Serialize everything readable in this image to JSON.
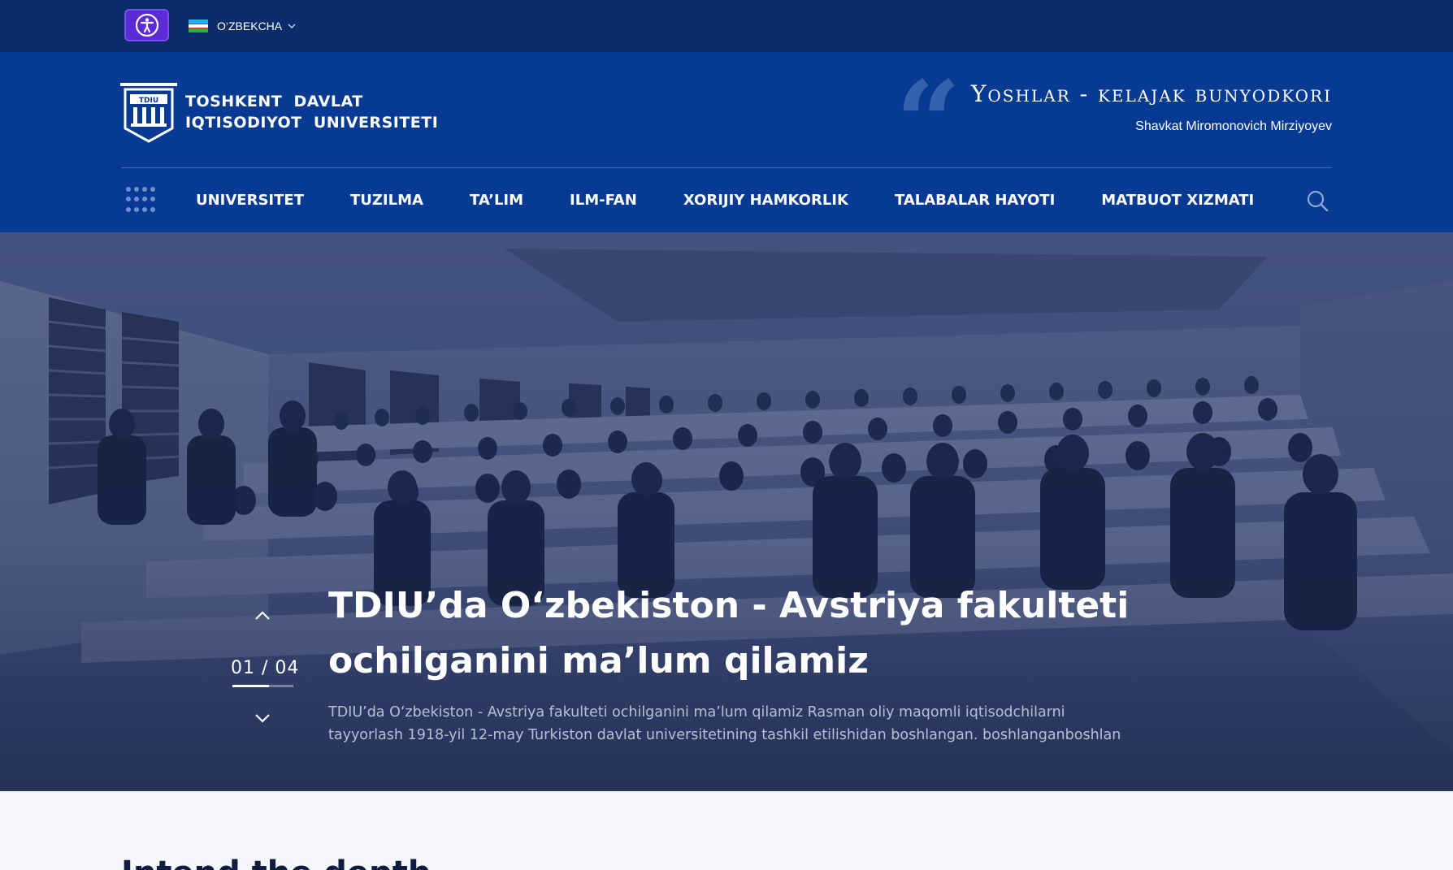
{
  "topbar": {
    "accessibility_icon": "accessibility-icon",
    "language": {
      "label": "O‘ZBEKCHA",
      "flag_colors": [
        "#1eb5e6",
        "#ffffff",
        "#1eb53a"
      ],
      "chevron_icon": "chevron-down-icon"
    }
  },
  "header": {
    "logo": {
      "mark_text": "TDIU",
      "line1": "TOSHKENT  DAVLAT",
      "line2": "IQTISODIYOT  UNIVERSITETI"
    },
    "motto": "Yoshlar - kelajak bunyodkori",
    "quote_mark": "“",
    "author": "Shavkat Miromonovich Mirziyoyev"
  },
  "nav": {
    "menu_icon": "grid-menu-icon",
    "items": [
      "UNIVERSITET",
      "TUZILMA",
      "TA’LIM",
      "ILM-FAN",
      "XORIJIY HAMKORLIK",
      "TALABALAR HAYOTI",
      "MATBUOT XIZMATI"
    ],
    "search_icon": "search-icon"
  },
  "hero": {
    "title": "TDIU’da O‘zbekiston - Avstriya fakulteti ochilganini ma’lum qilamiz",
    "description": "TDIU’da O‘zbekiston - Avstriya fakulteti ochilganini ma’lum qilamiz  Rasman oliy maqomli iqtisodchilarni tayyorlash 1918-yil 12-may Turkiston davlat universitetining tashkil etilishidan boshlangan. boshlanganboshlan",
    "counter": "01 / 04",
    "current_slide": 1,
    "total_slides": 4
  },
  "bottom": {
    "heading": "Intend the depth"
  },
  "colors": {
    "topbar": "#0b2c6a",
    "header": "#063a93",
    "accessibility": "#5b2bd6"
  }
}
